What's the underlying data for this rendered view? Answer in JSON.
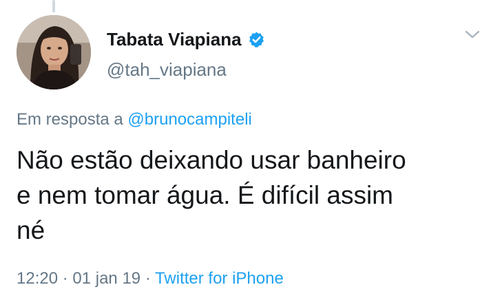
{
  "author": {
    "display_name": "Tabata Viapiana",
    "handle": "@tah_viapiana",
    "verified": true
  },
  "reply": {
    "prefix": "Em resposta a",
    "handle": "@brunocampiteli"
  },
  "tweet": {
    "text": "Não estão deixando usar banheiro\ne nem tomar água. É difícil assim\nné"
  },
  "meta": {
    "time": "12:20",
    "separator1": " · ",
    "date": "01 jan 19",
    "separator2": " · ",
    "source": "Twitter for iPhone"
  },
  "icons": {
    "verified": "verified-badge-icon",
    "menu": "chevron-down-icon"
  },
  "colors": {
    "link_blue": "#1da1f2",
    "text_dark": "#14171a",
    "text_gray": "#657786"
  }
}
